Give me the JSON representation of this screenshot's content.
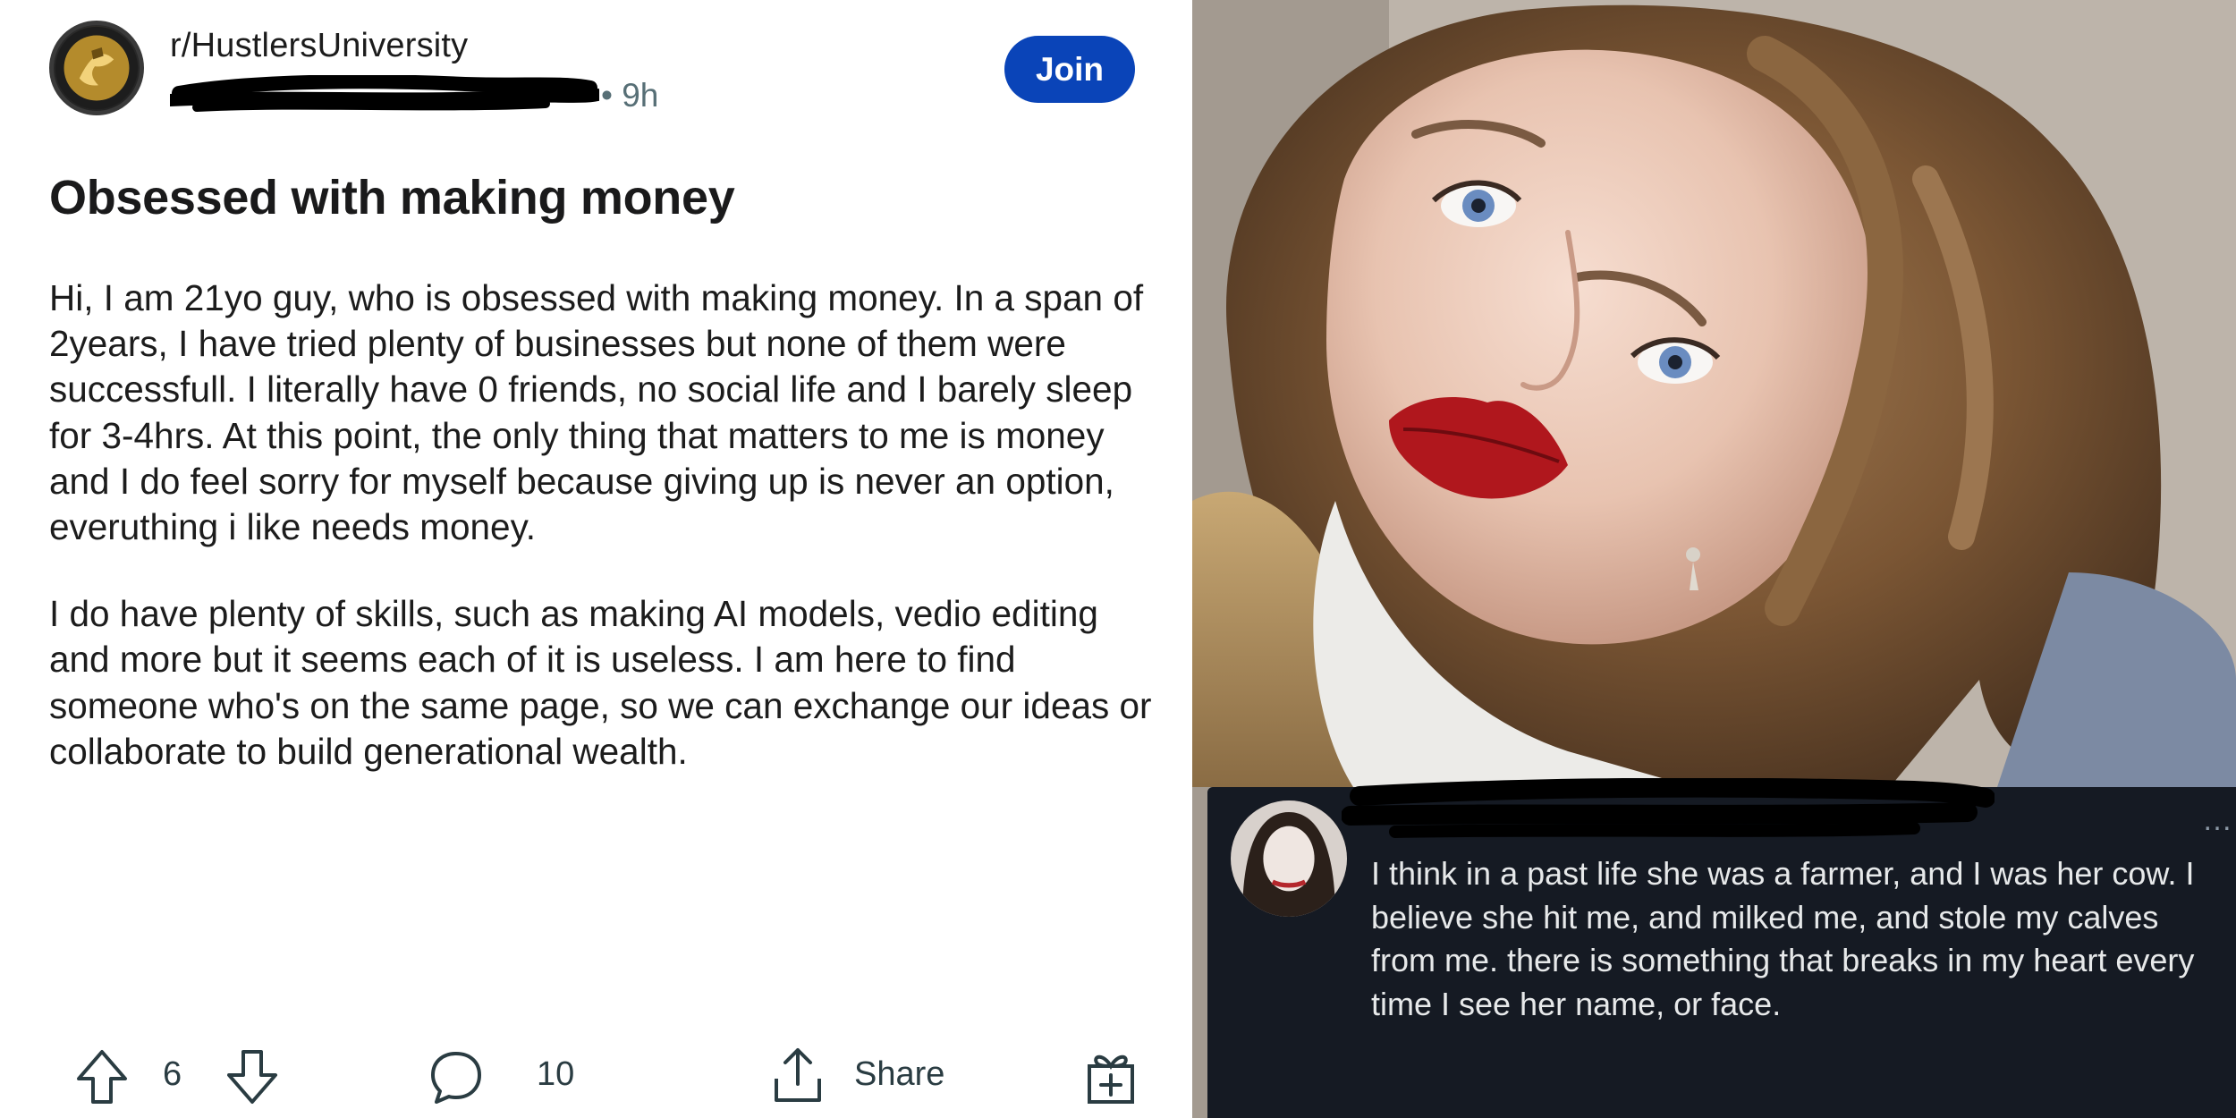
{
  "post": {
    "subreddit": "r/HustlersUniversity",
    "time": "• 9h",
    "join_label": "Join",
    "title": "Obsessed with making money",
    "paragraphs": [
      "Hi, I am 21yo guy, who is obsessed with making money. In a span of 2years, I have tried plenty of businesses but none of them were successfull. I literally have 0 friends, no social life and I barely sleep for 3-4hrs. At this point, the only thing that matters to me is money and I do feel sorry for myself because giving up is never an option, everuthing i like needs money.",
      "I do have plenty of skills, such as making AI models, vedio editing and more but it seems each of it is useless. I am here to find someone who's on the same page, so we can exchange our  ideas or collaborate to build generational wealth."
    ],
    "vote_count": "6",
    "comment_count": "10",
    "share_label": "Share"
  },
  "tweet": {
    "menu": "…",
    "text": "I think in a past life she was a farmer, and I was her cow. I believe she hit me, and milked me, and stole my calves from me. there is something that breaks in my heart every time I see her name, or face."
  },
  "colors": {
    "join_button": "#0a44b8",
    "tweet_background": "#151a23",
    "tweet_text": "#e7e9ea",
    "lipstick": "#b0171d"
  },
  "icons": {
    "subreddit_avatar": "subreddit-avatar-icon",
    "upvote": "upvote-icon",
    "downvote": "downvote-icon",
    "comment": "comment-icon",
    "share": "share-icon",
    "award": "award-icon"
  }
}
